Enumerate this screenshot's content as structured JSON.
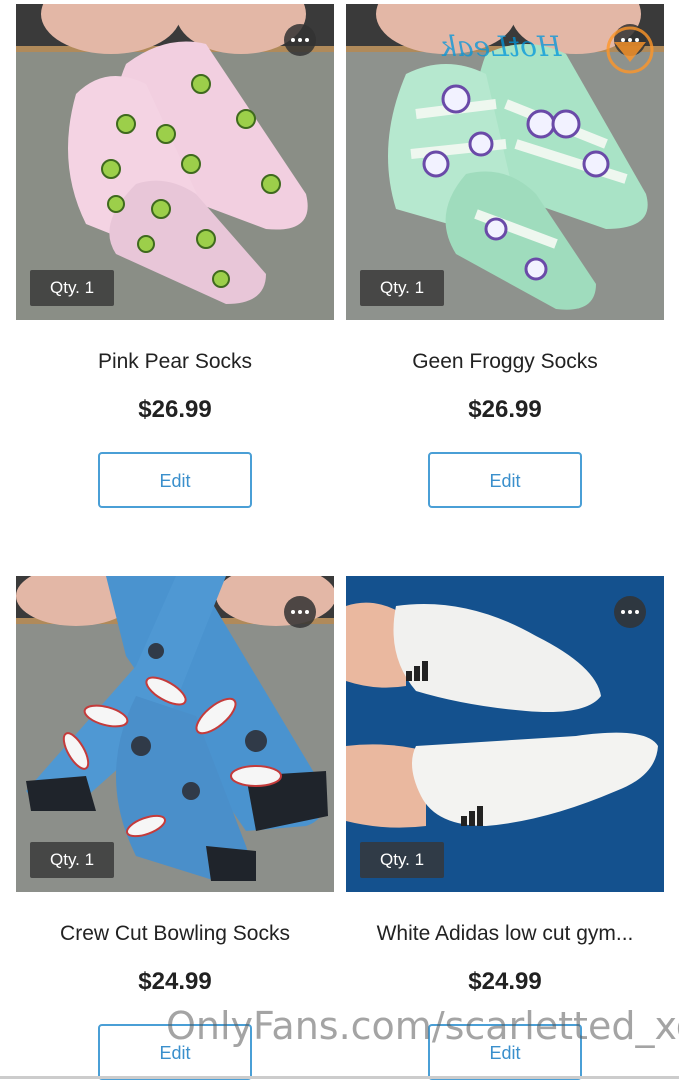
{
  "products": [
    {
      "title": "Pink Pear Socks",
      "price": "$26.99",
      "qty": "Qty. 1",
      "edit_label": "Edit",
      "photo": "pink-sock-photo"
    },
    {
      "title": "Geen Froggy Socks",
      "price": "$26.99",
      "qty": "Qty. 1",
      "edit_label": "Edit",
      "photo": "green-sock-photo"
    },
    {
      "title": "Crew Cut Bowling Socks",
      "price": "$24.99",
      "qty": "Qty. 1",
      "edit_label": "Edit",
      "photo": "bowling-sock-photo"
    },
    {
      "title": "White Adidas low cut gym...",
      "price": "$24.99",
      "qty": "Qty. 1",
      "edit_label": "Edit",
      "photo": "white-sock-photo"
    }
  ],
  "watermark": "OnlyFans.com/scarletted_xo",
  "overlay_logo": "HotLeak",
  "colors": {
    "accent": "#4a9fd6",
    "price_text": "#222222",
    "badge_bg": "#373737"
  },
  "icons": [
    "more-options-icon"
  ]
}
